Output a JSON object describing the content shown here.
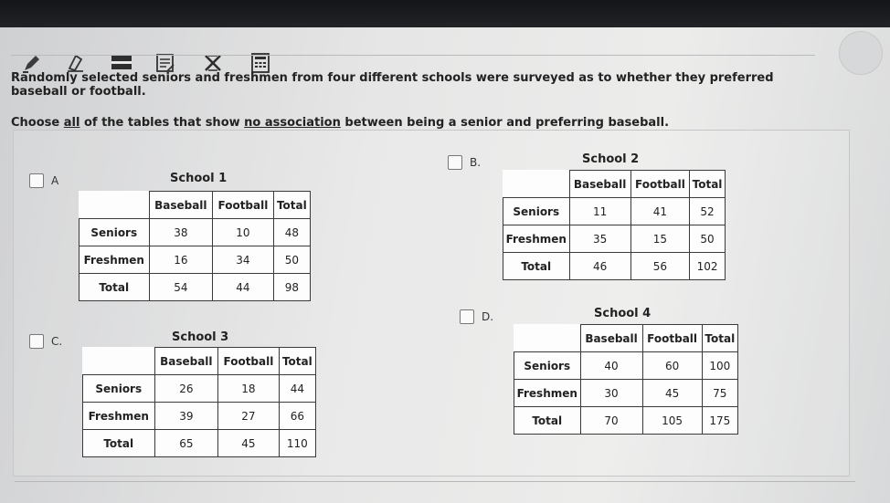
{
  "question": {
    "intro": "Randomly selected seniors and freshmen from four different schools were surveyed as to whether they preferred baseball or football.",
    "prompt_before_all": "Choose ",
    "prompt_all": "all",
    "prompt_mid": " of the tables that show ",
    "prompt_no_assoc": "no association",
    "prompt_after": " between being a senior and preferring baseball."
  },
  "headers": [
    "Baseball",
    "Football",
    "Total"
  ],
  "options": [
    {
      "letter": "A",
      "school": "School 1",
      "rows": [
        {
          "label": "Seniors",
          "values": [
            "38",
            "10",
            "48"
          ]
        },
        {
          "label": "Freshmen",
          "values": [
            "16",
            "34",
            "50"
          ]
        },
        {
          "label": "Total",
          "values": [
            "54",
            "44",
            "98"
          ]
        }
      ]
    },
    {
      "letter": "B.",
      "school": "School 2",
      "rows": [
        {
          "label": "Seniors",
          "values": [
            "11",
            "41",
            "52"
          ]
        },
        {
          "label": "Freshmen",
          "values": [
            "35",
            "15",
            "50"
          ]
        },
        {
          "label": "Total",
          "values": [
            "46",
            "56",
            "102"
          ]
        }
      ]
    },
    {
      "letter": "C.",
      "school": "School 3",
      "rows": [
        {
          "label": "Seniors",
          "values": [
            "26",
            "18",
            "44"
          ]
        },
        {
          "label": "Freshmen",
          "values": [
            "39",
            "27",
            "66"
          ]
        },
        {
          "label": "Total",
          "values": [
            "65",
            "45",
            "110"
          ]
        }
      ]
    },
    {
      "letter": "D.",
      "school": "School 4",
      "rows": [
        {
          "label": "Seniors",
          "values": [
            "40",
            "60",
            "100"
          ]
        },
        {
          "label": "Freshmen",
          "values": [
            "30",
            "45",
            "75"
          ]
        },
        {
          "label": "Total",
          "values": [
            "70",
            "105",
            "175"
          ]
        }
      ]
    }
  ],
  "toolbar": {
    "icons": [
      "pen-icon",
      "eraser-icon",
      "line-reader-icon",
      "notepad-icon",
      "eliminate-choice-icon",
      "calculator-icon"
    ]
  }
}
